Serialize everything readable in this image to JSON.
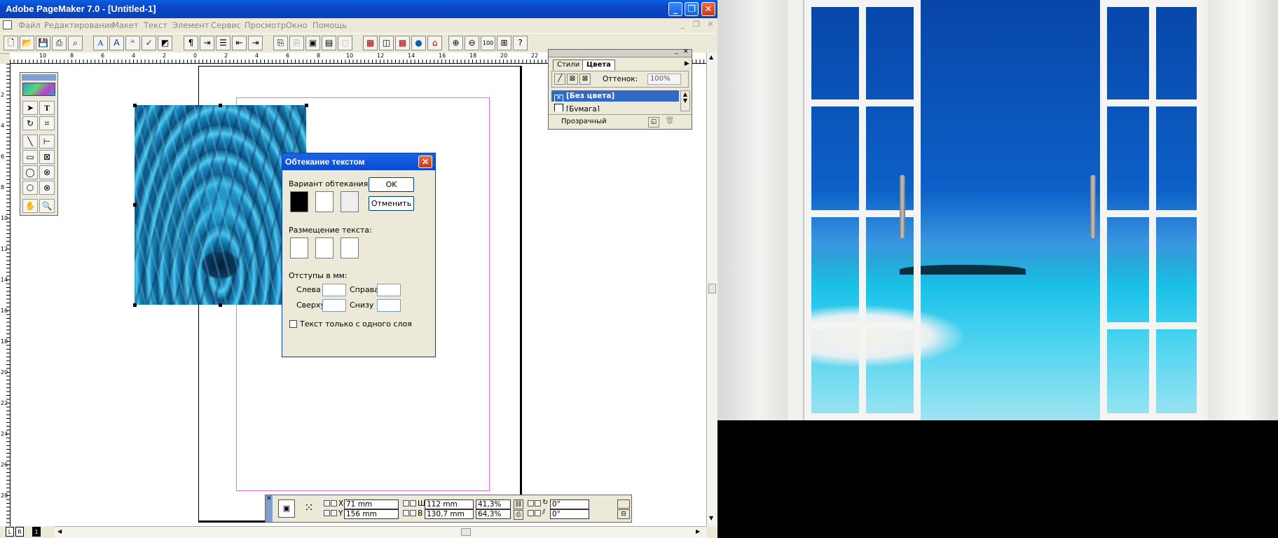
{
  "window": {
    "title": "Adobe PageMaker 7.0 - [Untitled-1]",
    "min": "_",
    "max": "❐",
    "close": "✕"
  },
  "menu": {
    "items": [
      "Файл",
      "Редактирование",
      "Макет",
      "Текст",
      "Элемент",
      "Сервис",
      "Просмотр",
      "Окно",
      "Помощь"
    ],
    "doc_min": "_",
    "doc_max": "❐",
    "doc_close": "✕"
  },
  "ruler": {
    "h_labels": [
      "10",
      "8",
      "6",
      "4",
      "2",
      "0",
      "2",
      "4",
      "6",
      "8",
      "10",
      "12",
      "14",
      "16",
      "18",
      "20",
      "22"
    ],
    "v_labels": [
      "2",
      "4",
      "6",
      "8",
      "10",
      "12",
      "14",
      "16",
      "18",
      "20",
      "22",
      "24",
      "26",
      "28"
    ]
  },
  "palette": {
    "tabs": [
      "Стили",
      "Цвета"
    ],
    "shade_label": "Оттенок:",
    "shade_value": "100%",
    "swatches": [
      "[Без цвета]",
      "[Бумага]"
    ],
    "footer": "Прозрачный"
  },
  "dialog": {
    "title": "Обтекание текстом",
    "wrap_label": "Вариант обтекания:",
    "placement_label": "Размещение текста:",
    "offsets_label": "Отступы в  мм:",
    "left": "Слева",
    "right": "Справа",
    "top": "Сверху",
    "bottom": "Снизу",
    "single_layer": "Текст только с одного слоя",
    "ok": "OK",
    "cancel": "Отменить"
  },
  "control": {
    "x_label": "X",
    "y_label": "Y",
    "w_label": "Ш",
    "h_label": "В",
    "x": "71 mm",
    "y": "156 mm",
    "w": "112 mm",
    "h": "130,7 mm",
    "w_pct": "41,3%",
    "h_pct": "64,3%",
    "rot": "0°",
    "skew": "0°"
  },
  "pages": {
    "left": "L",
    "right": "R",
    "current": "1"
  }
}
